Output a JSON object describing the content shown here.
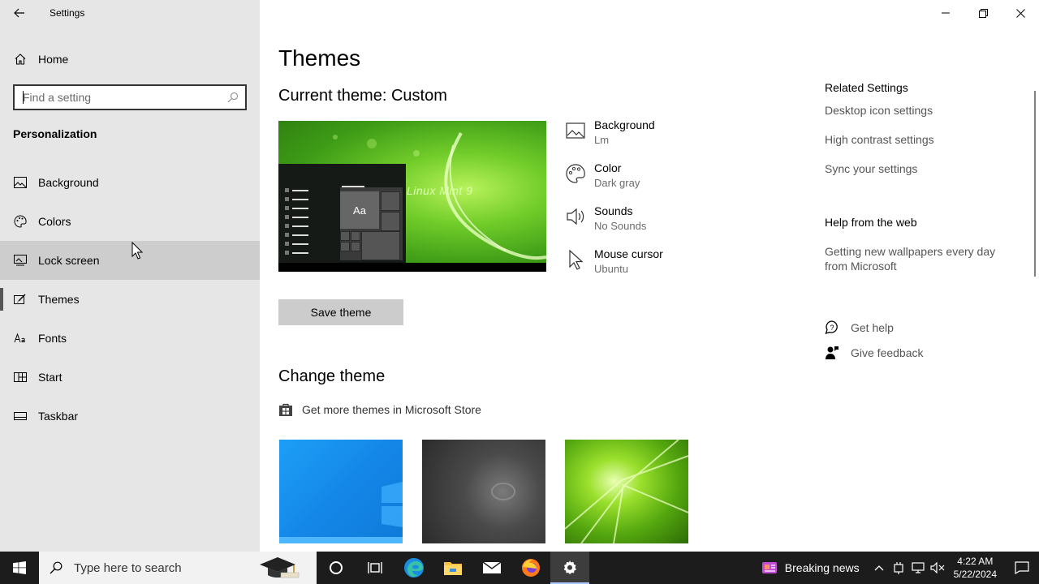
{
  "app": {
    "title": "Settings"
  },
  "sidebar": {
    "home_label": "Home",
    "search_placeholder": "Find a setting",
    "section_title": "Personalization",
    "items": [
      {
        "label": "Background",
        "icon": "picture-icon"
      },
      {
        "label": "Colors",
        "icon": "palette-icon"
      },
      {
        "label": "Lock screen",
        "icon": "lock-screen-icon"
      },
      {
        "label": "Themes",
        "icon": "brush-icon"
      },
      {
        "label": "Fonts",
        "icon": "fonts-icon"
      },
      {
        "label": "Start",
        "icon": "start-icon"
      },
      {
        "label": "Taskbar",
        "icon": "taskbar-icon"
      }
    ],
    "selected": "Themes",
    "hovered": "Lock screen"
  },
  "main": {
    "page_title": "Themes",
    "current_theme": "Current theme: Custom",
    "preview_text": {
      "tile": "Aa",
      "wallpaper": "Linux Mint 9"
    },
    "properties": [
      {
        "title": "Background",
        "value": "Lm"
      },
      {
        "title": "Color",
        "value": "Dark gray"
      },
      {
        "title": "Sounds",
        "value": "No Sounds"
      },
      {
        "title": "Mouse cursor",
        "value": "Ubuntu"
      }
    ],
    "save_button": "Save theme",
    "change_theme_title": "Change theme",
    "store_link": "Get more themes in Microsoft Store",
    "related": {
      "heading": "Related Settings",
      "links": [
        "Desktop icon settings",
        "High contrast settings",
        "Sync your settings"
      ]
    },
    "help_web": {
      "heading": "Help from the web",
      "link": "Getting new wallpapers every day from Microsoft"
    },
    "get_help": "Get help",
    "give_feedback": "Give feedback"
  },
  "taskbar": {
    "search_placeholder": "Type here to search",
    "news": "Breaking news",
    "time": "4:22 AM",
    "date": "5/22/2024"
  },
  "colors": {
    "sidebar_bg": "#e6e6e6",
    "taskbar_bg": "#1c1c1c",
    "accent_indicator": "#555555"
  }
}
